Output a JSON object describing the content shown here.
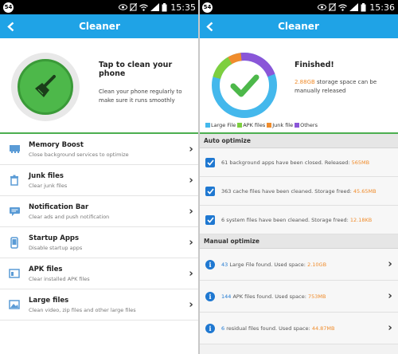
{
  "colors": {
    "accent": "#1fa3e6",
    "green": "#4db84a",
    "orange": "#f08c2c",
    "blue": "#1f78d1",
    "legend_large": "#44b8ec",
    "legend_apk": "#7dcf3f",
    "legend_junk": "#f08c2c",
    "legend_others": "#8a56d8"
  },
  "left": {
    "status": {
      "badge": "54",
      "time": "15:35"
    },
    "title": "Cleaner",
    "hero": {
      "title": "Tap to clean your phone",
      "desc": "Clean your phone regularly to make sure it runs smoothly"
    },
    "items": [
      {
        "title": "Memory Boost",
        "sub": "Close background services to optimize",
        "icon": "memory-icon"
      },
      {
        "title": "Junk files",
        "sub": "Clear junk files",
        "icon": "trash-icon"
      },
      {
        "title": "Notification Bar",
        "sub": "Clear ads and push notification",
        "icon": "notification-icon"
      },
      {
        "title": "Startup Apps",
        "sub": "Disable startup apps",
        "icon": "phone-icon"
      },
      {
        "title": "APK files",
        "sub": "Clear installed APK files",
        "icon": "apk-icon"
      },
      {
        "title": "Large files",
        "sub": "Clean video, zip files and other large files",
        "icon": "image-icon"
      }
    ]
  },
  "right": {
    "status": {
      "badge": "54",
      "time": "15:36"
    },
    "title": "Cleaner",
    "finished": "Finished!",
    "freed_amount": "2.88GB",
    "freed_text": " storage space can be manually released",
    "legend": [
      "Large File",
      "APK files",
      "Junk file",
      "Others"
    ],
    "auto_section": "Auto optimize",
    "auto_items": [
      {
        "pre": "61 background apps have been closed. Released: ",
        "amt": "565MB"
      },
      {
        "pre": "363 cache files have been cleaned. Storage freed: ",
        "amt": "45.65MB"
      },
      {
        "pre": "6 system files have been cleaned. Storage freed: ",
        "amt": "12.18KB"
      }
    ],
    "manual_section": "Manual optimize",
    "manual_items": [
      {
        "count": "43",
        "pre": " Large File found. Used space: ",
        "amt": "2.10GB"
      },
      {
        "count": "144",
        "pre": " APK files found. Used space: ",
        "amt": "753MB"
      },
      {
        "count": "6",
        "pre": " residual files found. Used space: ",
        "amt": "44.87MB"
      }
    ]
  }
}
